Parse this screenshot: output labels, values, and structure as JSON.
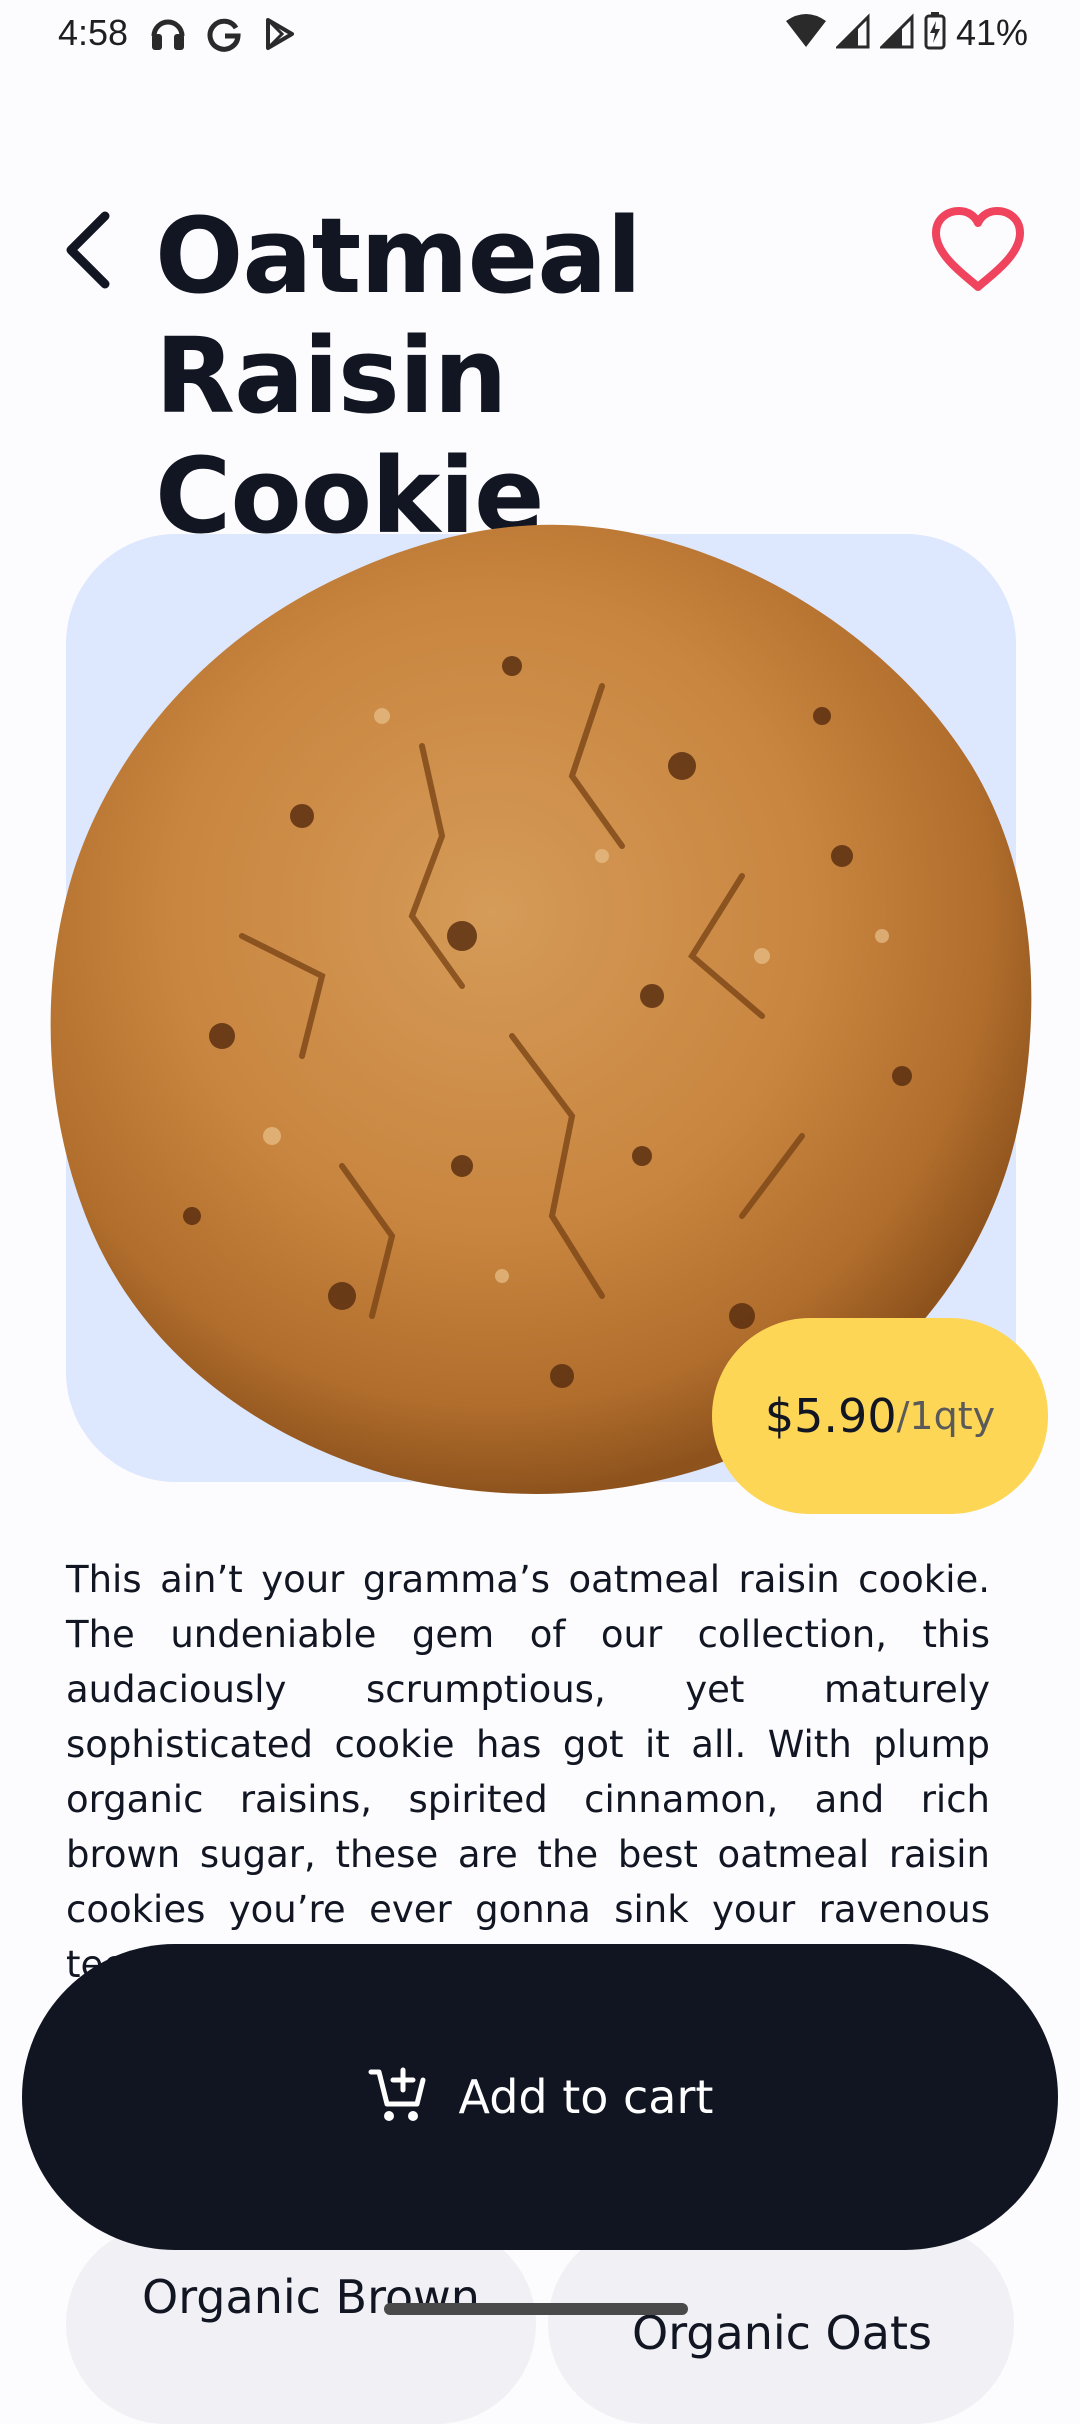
{
  "status_bar": {
    "time": "4:58",
    "battery": "41%",
    "left_icons": [
      "headset-icon",
      "google-icon",
      "play-store-icon"
    ],
    "right_icons": [
      "wifi-icon",
      "signal-icon",
      "signal-icon",
      "battery-charging-icon"
    ]
  },
  "product": {
    "title": "Oatmeal Raisin Cookie",
    "price": "$5.90",
    "price_unit": "/1qty",
    "description": "This ain’t your gramma’s oatmeal raisin cookie. The undeniable gem of our collection, this audaciously scrumptious, yet maturely sophisticated cookie has got it all. With plump organic raisins, spirited cinnamon, and rich brown sugar, these are the best oatmeal raisin cookies you’re ever gonna sink your ravenous teeth into."
  },
  "ingredients": [
    {
      "label": "Organic Brown"
    },
    {
      "label": "Organic Oats"
    }
  ],
  "actions": {
    "add_to_cart": "Add to cart"
  },
  "colors": {
    "background": "#fcfcfe",
    "image_card": "#dde7fd",
    "price_badge": "#fdd656",
    "primary_button": "#111522",
    "favorite": "#f0445e",
    "text": "#121623"
  }
}
